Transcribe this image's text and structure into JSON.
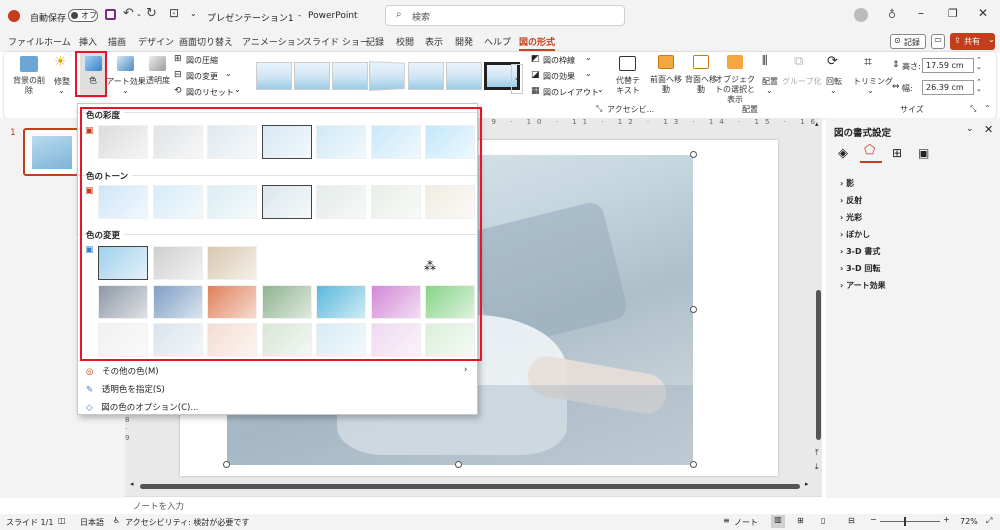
{
  "titlebar": {
    "autosave_label": "自動保存",
    "autosave_state": "オフ",
    "doc_title": "プレゼンテーション1",
    "app_name": "PowerPoint",
    "separator": "-",
    "search_placeholder": "検索"
  },
  "tabs": [
    "ファイル",
    "ホーム",
    "挿入",
    "描画",
    "デザイン",
    "画面切り替え",
    "アニメーション",
    "スライド ショー",
    "記録",
    "校閲",
    "表示",
    "開発",
    "ヘルプ",
    "図の形式"
  ],
  "tab_actions": {
    "record": "記録",
    "share": "共有"
  },
  "ribbon": {
    "remove_bg": "背景の削除",
    "corrections": "修整",
    "color": "色",
    "artistic_effects": "アート効果",
    "transparency": "透明度",
    "compress": "図の圧縮",
    "change_picture": "図の変更",
    "reset_picture": "図のリセット",
    "picture_border": "図の枠線",
    "picture_effects": "図の効果",
    "picture_layout": "図のレイアウト",
    "accessibility_group": "アクセシビ...",
    "alt_text": "代替テキスト",
    "bring_forward": "前面へ移動",
    "send_backward": "背面へ移動",
    "selection_pane": "オブジェクトの選択と表示",
    "align": "配置",
    "group": "グループ化",
    "rotate": "回転",
    "arrange_group": "配置",
    "crop": "トリミング",
    "height_label": "高さ:",
    "height_value": "17.59 cm",
    "width_label": "幅:",
    "width_value": "26.39 cm",
    "size_group": "サイズ"
  },
  "dropdown": {
    "saturation_header": "色の彩度",
    "tone_header": "色のトーン",
    "recolor_header": "色の変更",
    "saturation_colors": [
      "#dcdcdc",
      "#e0e4e6",
      "#dfe8ee",
      "#d6e8f3",
      "#cfe9f7",
      "#c9e8f9",
      "#c3e7fb"
    ],
    "tone_colors": [
      "#cfe6f8",
      "#d6ecf7",
      "#dcedf3",
      "#dbe7ec",
      "#e3ebe9",
      "#e9eee6",
      "#f0ece2"
    ],
    "recolor_row1": [
      "#9fd0ec",
      "#cfcfcf",
      "#d8c8b0"
    ],
    "recolor_row2": [
      "#8e98a4",
      "#7f9fc4",
      "#e0805a",
      "#8fb38f",
      "#5ab8dd",
      "#d387d8",
      "#86d486"
    ],
    "recolor_row3": [
      "#f0f0f0",
      "#d9e3ec",
      "#f4ddd2",
      "#d7e6d7",
      "#d6ebf4",
      "#eed9ef",
      "#dbefdb"
    ],
    "more_colors": "その他の色(M)",
    "set_transparent": "透明色を指定(S)",
    "color_options": "図の色のオプション(C)..."
  },
  "slide_panel": {
    "slide_number": "1"
  },
  "format_pane": {
    "title": "図の書式設定",
    "sections": [
      "影",
      "反射",
      "光彩",
      "ぼかし",
      "3-D 書式",
      "3-D 回転",
      "アート効果"
    ]
  },
  "notes_placeholder": "ノートを入力",
  "status": {
    "slide": "スライド 1/1",
    "language": "日本語",
    "accessibility": "アクセシビリティ: 検討が必要です",
    "notes": "ノート",
    "zoom": "72%"
  }
}
